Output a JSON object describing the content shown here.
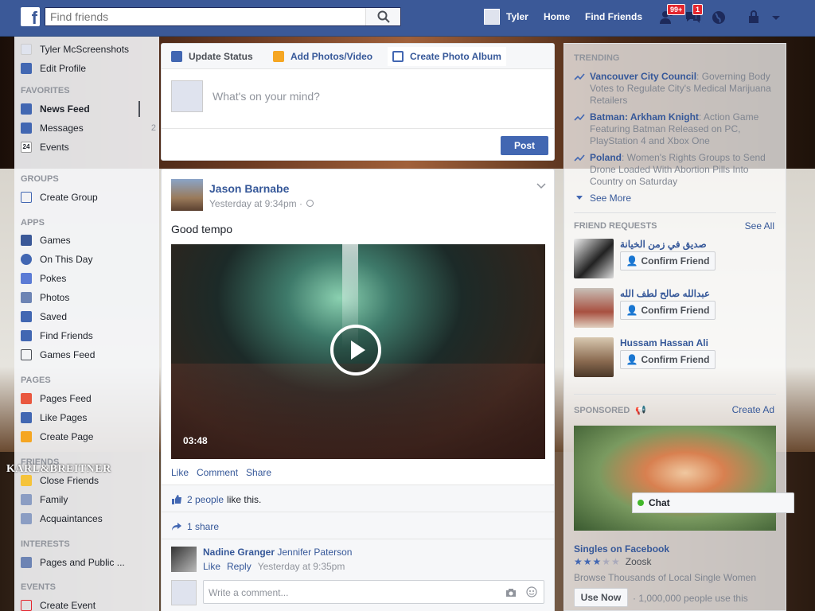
{
  "topbar": {
    "search_placeholder": "Find friends",
    "user_name": "Tyler",
    "home": "Home",
    "find_friends": "Find Friends",
    "friend_requests_badge": "99+",
    "messages_badge": "1"
  },
  "left": {
    "profile_name": "Tyler McScreenshots",
    "edit_profile": "Edit Profile",
    "favorites_head": "FAVORITES",
    "favorites": [
      {
        "label": "News Feed",
        "count": ""
      },
      {
        "label": "Messages",
        "count": "2"
      },
      {
        "label": "Events",
        "count": ""
      }
    ],
    "events_icon_text": "24",
    "groups_head": "GROUPS",
    "create_group": "Create Group",
    "apps_head": "APPS",
    "apps": [
      "Games",
      "On This Day",
      "Pokes",
      "Photos",
      "Saved",
      "Find Friends",
      "Games Feed"
    ],
    "pages_head": "PAGES",
    "pages": [
      "Pages Feed",
      "Like Pages",
      "Create Page"
    ],
    "friends_head": "FRIENDS",
    "friends": [
      "Close Friends",
      "Family",
      "Acquaintances"
    ],
    "interests_head": "INTERESTS",
    "interests": [
      "Pages and Public ..."
    ],
    "events_head": "EVENTS",
    "events": [
      "Create Event"
    ]
  },
  "watermark": "KARL&BREITNER",
  "composer": {
    "tab_status": "Update Status",
    "tab_photos": "Add Photos/Video",
    "tab_album": "Create Photo Album",
    "placeholder": "What's on your mind?",
    "post_button": "Post"
  },
  "post": {
    "author": "Jason Barnabe",
    "time": "Yesterday at 9:34pm ·",
    "text": "Good tempo",
    "video_duration": "03:48",
    "actions": [
      "Like",
      "Comment",
      "Share"
    ],
    "likes_link": "2 people",
    "likes_suffix": "like this.",
    "shares": "1 share",
    "comment": {
      "author": "Nadine Granger",
      "text": "Jennifer Paterson",
      "like": "Like",
      "reply": "Reply",
      "time": "Yesterday at 9:35pm"
    },
    "comment_placeholder": "Write a comment..."
  },
  "right": {
    "trending_head": "TRENDING",
    "trending": [
      {
        "topic": "Vancouver City Council",
        "desc": ": Governing Body Votes to Regulate City's Medical Marijuana Retailers"
      },
      {
        "topic": "Batman: Arkham Knight",
        "desc": ": Action Game Featuring Batman Released on PC, PlayStation 4 and Xbox One"
      },
      {
        "topic": "Poland",
        "desc": ": Women's Rights Groups to Send Drone Loaded With Abortion Pills Into Country on Saturday"
      }
    ],
    "see_more": "See More",
    "requests_head": "FRIEND REQUESTS",
    "see_all": "See All",
    "requests": [
      {
        "name": "صديق في زمن الخيانة"
      },
      {
        "name": "عبدالله صالح لطف الله"
      },
      {
        "name": "Hussam Hassan Ali"
      }
    ],
    "confirm_label": "Confirm Friend",
    "sponsored_head": "SPONSORED",
    "create_ad": "Create Ad",
    "ad_title": "Singles on Facebook",
    "ad_rating_source": "Zoosk",
    "ad_rating": 3.5,
    "ad_desc": "Browse Thousands of Local Single Women",
    "ad_button": "Use Now",
    "ad_social": "· 1,000,000 people use this",
    "chat_label": "Chat"
  },
  "colors": {
    "brand": "#3b5998",
    "link": "#365899",
    "badge": "#e4262e"
  }
}
